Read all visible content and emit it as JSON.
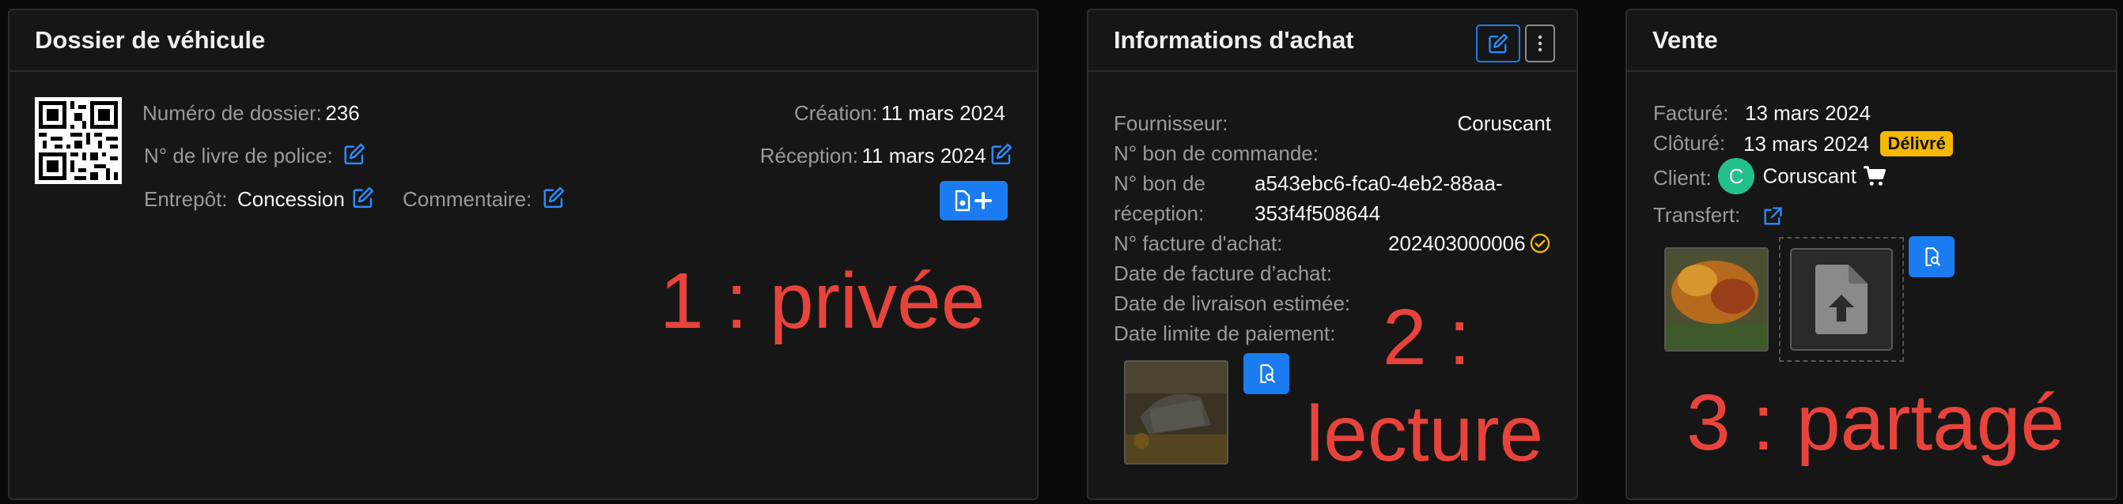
{
  "dossier": {
    "title": "Dossier de véhicule",
    "numero_label": "Numéro de dossier:",
    "numero_value": "236",
    "livre_police_label": "N° de livre de police:",
    "entrepot_label": "Entrepôt:",
    "entrepot_value": "Concession",
    "commentaire_label": "Commentaire:",
    "creation_label": "Création:",
    "creation_value": "11 mars 2024",
    "reception_label": "Réception:",
    "reception_value": "11 mars 2024"
  },
  "achat": {
    "title": "Informations d'achat",
    "fournisseur_label": "Fournisseur:",
    "fournisseur_value": "Coruscant",
    "bon_commande_label": "N° bon de commande:",
    "bon_reception_label_1": "N° bon de",
    "bon_reception_label_2": "réception:",
    "bon_reception_value_1": "a543ebc6-fca0-4eb2-88aa-",
    "bon_reception_value_2": "353f4f508644",
    "facture_label": "N° facture d'achat:",
    "facture_value": "202403000006",
    "date_facture_label": "Date de facture d’achat:",
    "date_livraison_label": "Date de livraison estimée:",
    "date_limite_label": "Date limite de paiement:"
  },
  "vente": {
    "title": "Vente",
    "facture_label": "Facturé:",
    "facture_value": "13 mars 2024",
    "cloture_label": "Clôturé:",
    "cloture_value": "13 mars 2024",
    "status_badge": "Délivré",
    "client_label": "Client:",
    "client_initial": "C",
    "client_value": "Coruscant",
    "transfert_label": "Transfert:"
  },
  "annotations": {
    "a1": "1 : privée",
    "a2_line1": "2 :",
    "a2_line2": "lecture",
    "a3": "3 : partagé"
  },
  "colors": {
    "accent": "#1a7cf0",
    "annotation": "#e8433b",
    "badge": "#f5b800",
    "avatar": "#23c08e"
  }
}
